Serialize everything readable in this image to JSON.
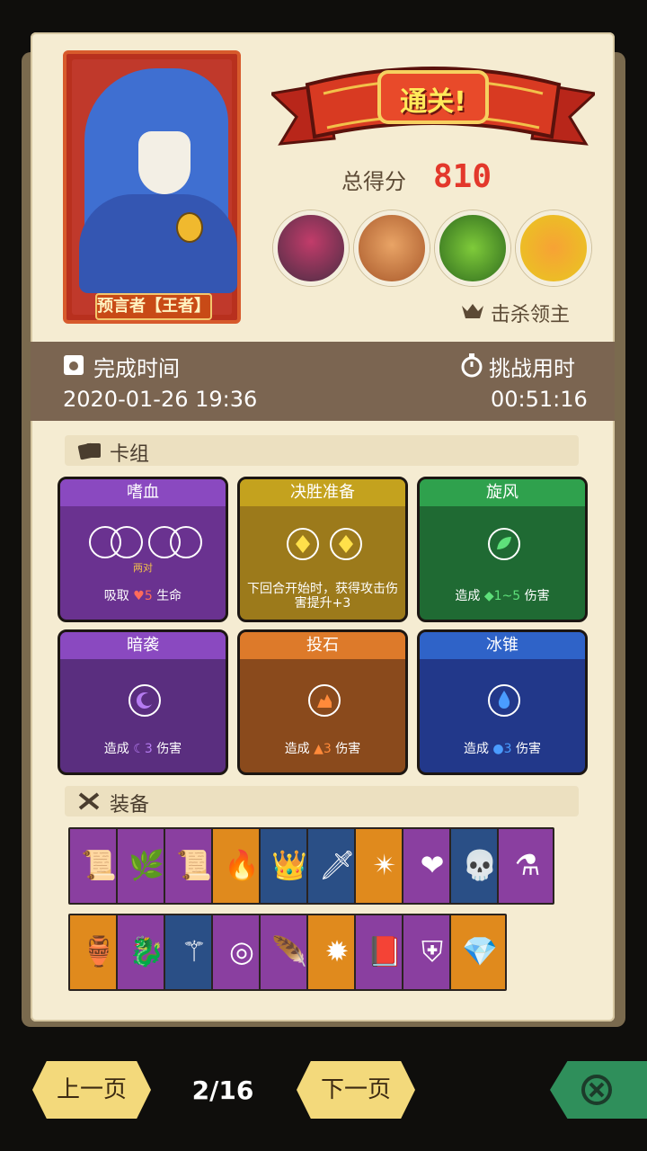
{
  "result": {
    "banner_text": "通关!",
    "score_label": "总得分",
    "score_value": "810",
    "kill_label": "击杀领主"
  },
  "character": {
    "name": "预言者【王者】"
  },
  "info": {
    "finish_time_label": "完成时间",
    "finish_time_value": "2020-01-26 19:36",
    "challenge_time_label": "挑战用时",
    "challenge_time_value": "00:51:16"
  },
  "deck": {
    "title": "卡组",
    "cards": [
      {
        "name": "嗜血",
        "desc_prefix": "吸取",
        "desc_value": "5",
        "desc_suffix": "生命",
        "sub": "两对",
        "color": "#6a3290",
        "header": "#8a49c0"
      },
      {
        "name": "决胜准备",
        "desc": "下回合开始时，获得攻击伤害提升+3",
        "color": "#9c7a1b",
        "header": "#c4a21e"
      },
      {
        "name": "旋风",
        "desc_prefix": "造成",
        "desc_value": "1~5",
        "desc_suffix": "伤害",
        "color": "#1f6a33",
        "header": "#2fa14d"
      },
      {
        "name": "暗袭",
        "desc_prefix": "造成",
        "desc_value": "3",
        "desc_suffix": "伤害",
        "color": "#5a2e7f",
        "header": "#8a49c0"
      },
      {
        "name": "投石",
        "desc_prefix": "造成",
        "desc_value": "3",
        "desc_suffix": "伤害",
        "color": "#8a4a1c",
        "header": "#dd7a2a"
      },
      {
        "name": "冰锥",
        "desc_prefix": "造成",
        "desc_value": "3",
        "desc_suffix": "伤害",
        "color": "#22388a",
        "header": "#2f63c8"
      }
    ]
  },
  "equipment": {
    "title": "装备",
    "row1": [
      {
        "bg": "#8a3fa0",
        "icon": "fire-scroll-icon",
        "glyph": "📜"
      },
      {
        "bg": "#8a3fa0",
        "icon": "green-horn-icon",
        "glyph": "🌿"
      },
      {
        "bg": "#8a3fa0",
        "icon": "stone-scroll-icon",
        "glyph": "📜"
      },
      {
        "bg": "#e08a1d",
        "icon": "red-blue-flame-icon",
        "glyph": "🔥"
      },
      {
        "bg": "#2a4f86",
        "icon": "ice-crown-icon",
        "glyph": "👑"
      },
      {
        "bg": "#2a4f86",
        "icon": "sword-scroll-icon",
        "glyph": "🗡"
      },
      {
        "bg": "#e08a1d",
        "icon": "green-shuriken-icon",
        "glyph": "✴"
      },
      {
        "bg": "#8a3fa0",
        "icon": "heart-shield-icon",
        "glyph": "❤"
      },
      {
        "bg": "#2a4f86",
        "icon": "skull-icon",
        "glyph": "💀"
      },
      {
        "bg": "#8a3fa0",
        "icon": "green-potion-icon",
        "glyph": "⚗"
      }
    ],
    "row2": [
      {
        "bg": "#e08a1d",
        "icon": "red-cup-icon",
        "glyph": "🏺"
      },
      {
        "bg": "#8a3fa0",
        "icon": "red-dragon-icon",
        "glyph": "🐉"
      },
      {
        "bg": "#2a4f86",
        "icon": "golden-staff-icon",
        "glyph": "⚚"
      },
      {
        "bg": "#8a3fa0",
        "icon": "golden-ring-icon",
        "glyph": "◎"
      },
      {
        "bg": "#8a3fa0",
        "icon": "fire-feather-icon",
        "glyph": "🪶"
      },
      {
        "bg": "#e08a1d",
        "icon": "spiked-ball-icon",
        "glyph": "✹"
      },
      {
        "bg": "#8a3fa0",
        "icon": "skull-book-icon",
        "glyph": "📕"
      },
      {
        "bg": "#8a3fa0",
        "icon": "armor-icon",
        "glyph": "⛨"
      },
      {
        "bg": "#e08a1d",
        "icon": "rainbow-gem-icon",
        "glyph": "💎"
      }
    ]
  },
  "nav": {
    "prev_label": "上一页",
    "page_indicator": "2/16",
    "next_label": "下一页"
  }
}
